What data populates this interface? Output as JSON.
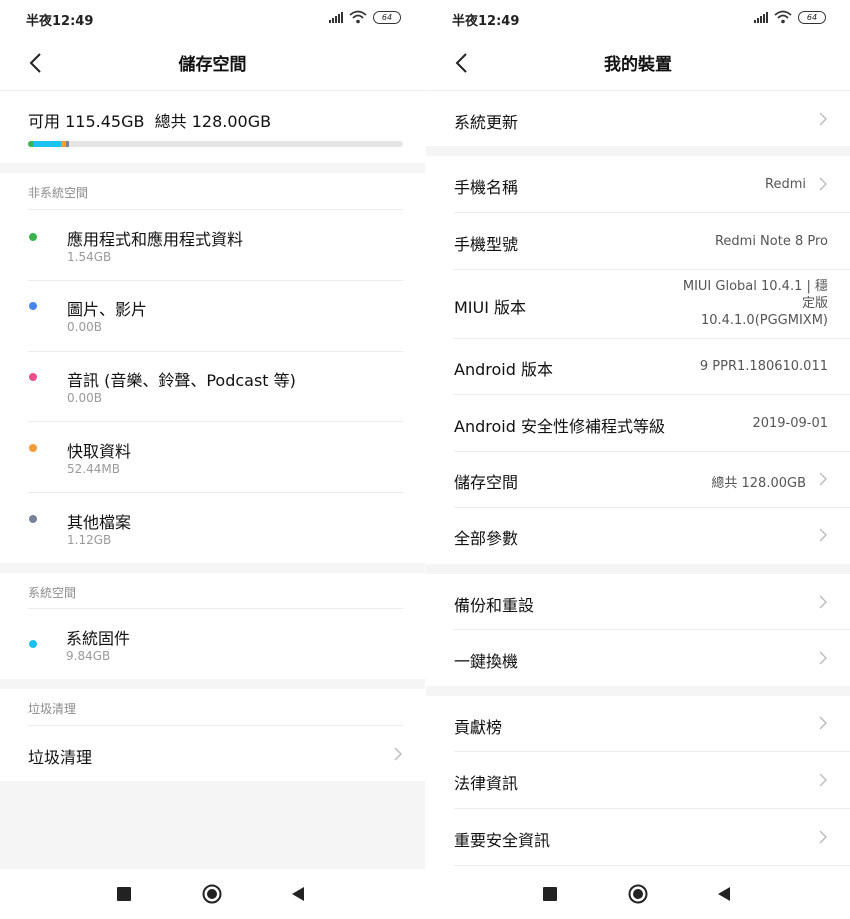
{
  "left": {
    "status": {
      "time": "半夜12:49",
      "battery": "64"
    },
    "title": "儲存空間",
    "summary": {
      "available": "可用 115.45GB",
      "total": "總共 128.00GB"
    },
    "usage_bar": [
      {
        "name": "apps",
        "fraction": 0.012,
        "color": "#3bb34a"
      },
      {
        "name": "system",
        "fraction": 0.077,
        "color": "#1fc1f0"
      },
      {
        "name": "cache",
        "fraction": 0.012,
        "color": "#f39a3b"
      },
      {
        "name": "other",
        "fraction": 0.009,
        "color": "#77839a"
      }
    ],
    "sections": {
      "non_system": {
        "header": "非系統空間",
        "items": [
          {
            "name": "應用程式和應用程式資料",
            "size": "1.54GB",
            "color": "#3bb34a"
          },
          {
            "name": "圖片、影片",
            "size": "0.00B",
            "color": "#4a86e8"
          },
          {
            "name": "音訊 (音樂、鈴聲、Podcast 等)",
            "size": "0.00B",
            "color": "#ea4f8c"
          },
          {
            "name": "快取資料",
            "size": "52.44MB",
            "color": "#f39a3b"
          },
          {
            "name": "其他檔案",
            "size": "1.12GB",
            "color": "#77839a"
          }
        ]
      },
      "system": {
        "header": "系統空間",
        "items": [
          {
            "name": "系統固件",
            "size": "9.84GB",
            "color": "#1fc1f0"
          }
        ]
      },
      "cleaner": {
        "header": "垃圾清理",
        "item": "垃圾清理"
      }
    }
  },
  "right": {
    "status": {
      "time": "半夜12:49",
      "battery": "64"
    },
    "title": "我的裝置",
    "rows": {
      "system_update": {
        "label": "系統更新"
      },
      "device_name": {
        "label": "手機名稱",
        "value": "Redmi"
      },
      "model": {
        "label": "手機型號",
        "value": "Redmi Note 8 Pro"
      },
      "miui": {
        "label": "MIUI 版本",
        "value1": "MIUI Global 10.4.1 | 穩",
        "value2": "定版",
        "value3": "10.4.1.0(PGGMIXM)"
      },
      "android": {
        "label": "Android 版本",
        "value": "9 PPR1.180610.011"
      },
      "security_patch": {
        "label": "Android 安全性修補程式等級",
        "value": "2019-09-01"
      },
      "storage": {
        "label": "儲存空間",
        "value": "總共 128.00GB"
      },
      "all_specs": {
        "label": "全部參數"
      },
      "backup": {
        "label": "備份和重設"
      },
      "migrate": {
        "label": "一鍵換機"
      },
      "contributors": {
        "label": "貢獻榜"
      },
      "legal": {
        "label": "法律資訊"
      },
      "safety": {
        "label": "重要安全資訊"
      }
    }
  }
}
